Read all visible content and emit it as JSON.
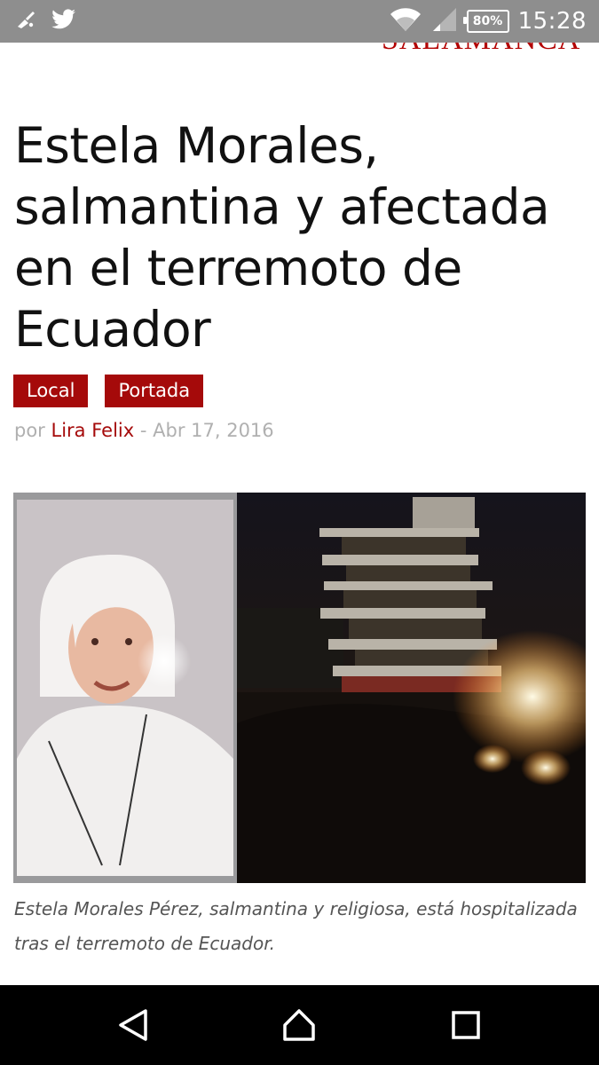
{
  "status_bar": {
    "icons_left": [
      "broom-icon",
      "twitter-icon"
    ],
    "battery": "80%",
    "time": "15:28"
  },
  "site": {
    "logo_text": "SALAMANCA"
  },
  "article": {
    "title": "Estela Morales, salmantina y afectada en el terremoto de Ecuador",
    "categories": [
      "Local",
      "Portada"
    ],
    "byline": {
      "prefix": "por",
      "author": "Lira Felix",
      "separator": "-",
      "date": "Abr 17, 2016"
    },
    "image_caption": "Estela Morales Pérez, salmantina y religiosa, está hospitalizada tras el terremoto de Ecuador."
  },
  "nav_bar": {
    "buttons": [
      "back-icon",
      "home-icon",
      "recents-icon"
    ]
  },
  "colors": {
    "accent": "#a50a0a",
    "status_bar": "#8e8e8e",
    "nav_bar": "#000000"
  }
}
